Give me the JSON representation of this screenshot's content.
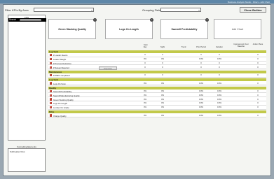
{
  "window": {
    "title": "Business Analysis Studio - Filters - Add Chart"
  },
  "filter": {
    "label": "Filter KPIs By Area",
    "value": ""
  },
  "grouping": {
    "label": "Grouping Field",
    "value": ""
  },
  "close_button": "Close Builder",
  "kpi_panel": {
    "title": "KPIs",
    "search_label": "Search",
    "search_value": ""
  },
  "formatting": {
    "title": "Formatting Elements",
    "items": [
      "Subheader Row"
    ]
  },
  "cards": [
    {
      "label": "Green Stacking Quality",
      "close": "x"
    },
    {
      "label": "Logs On Length",
      "close": "x"
    },
    {
      "label": "Sawmill Predictability",
      "close": "x"
    },
    {
      "label": "Add Chart",
      "close": ""
    }
  ],
  "table": {
    "group_header": "Start",
    "columns": [
      "Day",
      "Night",
      "Trend",
      "Prior Period",
      "Variation",
      "Improvement Over Baseline",
      "Action Plans"
    ],
    "sections": [
      {
        "title": "Log Yard",
        "rows": [
          {
            "name": "# Loader Events",
            "values": [
              "0",
              "0",
              "",
              "0",
              "0",
              "",
              "0"
            ]
          },
          {
            "name": "Loader Weight",
            "values": [
              "0%",
              "0%",
              "",
              "0.0%",
              "0.0%",
              "",
              "0"
            ]
          },
          {
            "name": "# Process Deduction",
            "values": [
              "0",
              "0",
              "",
              "0",
              "0",
              "",
              "0"
            ]
          },
          {
            "name": "# Sweep Rejected",
            "values": [
              "0",
              "0",
              "",
              "0",
              "0",
              "",
              "0"
            ]
          }
        ]
      },
      {
        "title": "Maintenance",
        "rows": [
          {
            "name": "# PMPs completed",
            "values": [
              "0",
              "0",
              "",
              "0",
              "0",
              "",
              "0"
            ]
          }
        ]
      },
      {
        "title": "Log Yard",
        "rows": [
          {
            "name": "Logs On Scan",
            "values": [
              "0%",
              "0%",
              "",
              "0.0%",
              "0.0%",
              "",
              "0"
            ]
          }
        ]
      },
      {
        "title": "Quality",
        "rows": [
          {
            "name": "Sawmill Predictability",
            "values": [
              "0%",
              "0%",
              "",
              "0.0%",
              "0.0%",
              "",
              "0"
            ]
          },
          {
            "name": "Sawmill Manufacturing Quality",
            "values": [
              "0%",
              "0%",
              "",
              "0.0%",
              "0.0%",
              "",
              "0"
            ]
          },
          {
            "name": "Green Stacking Quality",
            "values": [
              "0%",
              "0%",
              "",
              "0.0%",
              "0.0%",
              "",
              "0"
            ]
          },
          {
            "name": "Logs On Length",
            "values": [
              "0%",
              "0%",
              "",
              "0.0%",
              "0.0%",
              "",
              "0"
            ]
          },
          {
            "name": "Lumber On Grade",
            "values": [
              "0%",
              "0%",
              "",
              "0.0%",
              "0.0%",
              "",
              "0"
            ]
          }
        ]
      },
      {
        "title": "Kilns",
        "rows": [
          {
            "name": "Charge Quality",
            "values": [
              "0%",
              "0%",
              "",
              "0.0%",
              "0.0%",
              "",
              "0"
            ]
          }
        ]
      }
    ]
  },
  "tooltip": "Drop Here"
}
